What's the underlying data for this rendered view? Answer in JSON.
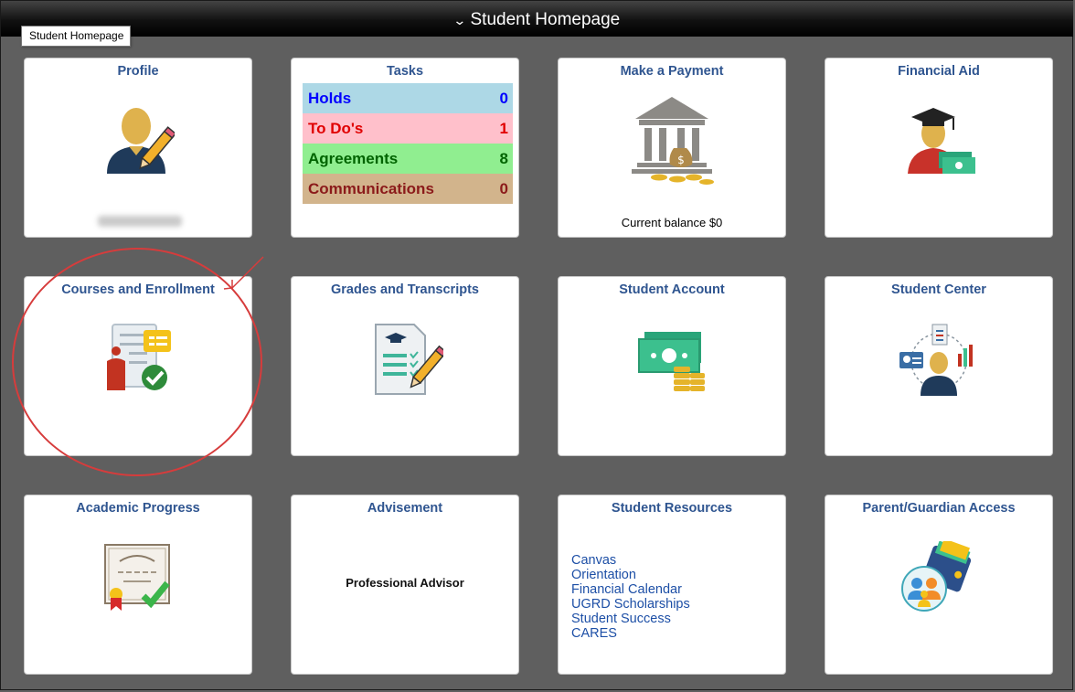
{
  "header": {
    "title": "Student Homepage",
    "tooltip": "Student Homepage"
  },
  "colors": {
    "tile_title": "#2f5590",
    "background": "#5f5f5f",
    "annotation": "#d63c3c"
  },
  "tiles": {
    "profile": {
      "title": "Profile",
      "icon": "user-pencil-icon"
    },
    "tasks": {
      "title": "Tasks",
      "rows": [
        {
          "label": "Holds",
          "count": "0",
          "color": "#0000ff",
          "bg": "#add8e6"
        },
        {
          "label": "To Do's",
          "count": "1",
          "color": "#e00000",
          "bg": "#ffc0cb"
        },
        {
          "label": "Agreements",
          "count": "8",
          "color": "#006400",
          "bg": "#90ee90"
        },
        {
          "label": "Communications",
          "count": "0",
          "color": "#8b1a1a",
          "bg": "#d2b48c"
        }
      ]
    },
    "payment": {
      "title": "Make a Payment",
      "balance": "Current balance $0",
      "icon": "bank-icon"
    },
    "financial_aid": {
      "title": "Financial Aid",
      "icon": "graduate-money-icon"
    },
    "courses": {
      "title": "Courses and Enrollment",
      "icon": "enrollment-checklist-icon"
    },
    "grades": {
      "title": "Grades and Transcripts",
      "icon": "transcript-pencil-icon"
    },
    "account": {
      "title": "Student Account",
      "icon": "cash-coins-icon"
    },
    "center": {
      "title": "Student Center",
      "icon": "student-center-icon"
    },
    "academic": {
      "title": "Academic Progress",
      "icon": "diploma-check-icon"
    },
    "advisement": {
      "title": "Advisement",
      "advisor": "Professional Advisor"
    },
    "resources": {
      "title": "Student Resources",
      "links": [
        "Canvas",
        "Orientation",
        "Financial Calendar",
        "UGRD Scholarships",
        "Student Success",
        "CARES"
      ]
    },
    "parent": {
      "title": "Parent/Guardian Access",
      "icon": "family-wallet-icon"
    }
  }
}
